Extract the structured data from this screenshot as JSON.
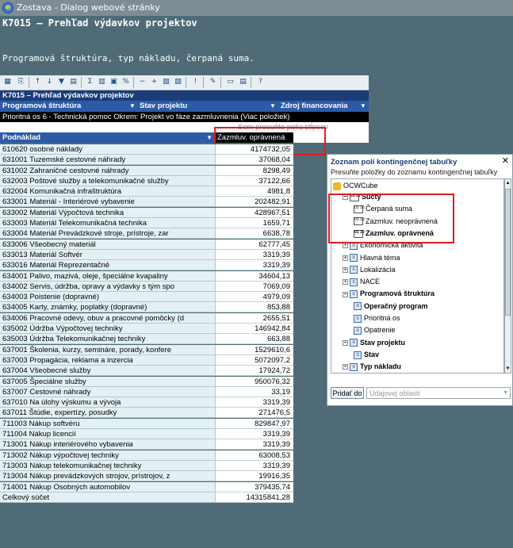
{
  "window": {
    "title": "Zostava - Dialog webové stránky"
  },
  "page": {
    "heading": "K7015 – Prehľad výdavkov projektov",
    "subheading": "Programová štruktúra, typ nákladu, čerpaná suma."
  },
  "pivot": {
    "title": "K7015 – Prehľad výdavkov projektov",
    "filter_fields": [
      "Programová štruktúra",
      "Stav projektu",
      "Zdroj financovania"
    ],
    "filter_row": "Prioritná os 6 - Technická pomoc Okrem: Projekt vo fáze zazmluvnenia (Viac položiek)",
    "drop_placeholder": "Sem presuňte polia stĺpcov",
    "row_header": "Podnáklad",
    "data_header": "Zazmluv. oprávnená",
    "rows": [
      {
        "label": "610620 osobné náklady",
        "value": "4174732,05"
      },
      {
        "label": "631001 Tuzemské cestovné náhrady",
        "value": "37068,04"
      },
      {
        "label": "631002 Zahraničné cestovné náhrady",
        "value": "8298,49"
      },
      {
        "label": "632003 Poštové služby a telekomunikačné služby",
        "value": "37122,66"
      },
      {
        "label": "632004 Komunikačná infraštruktúra",
        "value": "4981,8"
      },
      {
        "label": "633001 Materiál - Interiérové vybavenie",
        "value": "202482,91"
      },
      {
        "label": "633002 Materiál Výpočtová technika",
        "value": "428967,51"
      },
      {
        "label": "633003 Materiál Telekomunikačná technika",
        "value": "1659,71"
      },
      {
        "label": "633004 Materiál Prevádzkové stroje, prístroje, zar",
        "value": "6638,78"
      },
      {
        "label": "633006  Všeobecný materiál",
        "value": "62777,45"
      },
      {
        "label": "633013 Materiál Softvér",
        "value": "3319,39"
      },
      {
        "label": "633016 Materiál Reprezentačné",
        "value": "3319,39"
      },
      {
        "label": "634001  Palivo, mazivá, oleje, špeciálne kvapaliny",
        "value": "34604,13"
      },
      {
        "label": "634002  Servis, údržba, opravy a výdavky s tým spo",
        "value": "7069,09"
      },
      {
        "label": "634003  Poistenie (dopravné)",
        "value": "4979,09"
      },
      {
        "label": "634005  Karty, známky, poplatky (dopravné)",
        "value": "853,88"
      },
      {
        "label": "634006  Pracovné odevy, obuv a pracovné pomôcky (d",
        "value": "2655,51"
      },
      {
        "label": "635002 Údržba Výpočtovej techniky",
        "value": "146942,84"
      },
      {
        "label": "635003 Údržba Telekomunikačnej techniky",
        "value": "663,88"
      },
      {
        "label": "637001  Školenia, kurzy, semináre, porady, konfere",
        "value": "1529610,6"
      },
      {
        "label": "637003  Propagácia, reklama a inzercia",
        "value": "5072097,2"
      },
      {
        "label": "637004  Všeobecné služby",
        "value": "17924,72"
      },
      {
        "label": "637005  Špeciálne služby",
        "value": "950076,32"
      },
      {
        "label": "637007  Cestovné náhrady",
        "value": "33,19"
      },
      {
        "label": "637010  Na úlohy výskumu a vývoja",
        "value": "3319,39"
      },
      {
        "label": "637011  Štúdie, expertízy, posudky",
        "value": "271476,5"
      },
      {
        "label": "711003  Nákup softvéru",
        "value": "829847,97"
      },
      {
        "label": "711004  Nákup licencií",
        "value": "3319,39"
      },
      {
        "label": "713001  Nákup interiérového vybavenia",
        "value": "3319,39"
      },
      {
        "label": "713002  Nákup výpočtovej techniky",
        "value": "63008,53"
      },
      {
        "label": "713003  Nákup telekomunikačnej techniky",
        "value": "3319,39"
      },
      {
        "label": "713004  Nákup prevádzkových strojov, prístrojov, z",
        "value": "19916,35"
      },
      {
        "label": "714001  Nákup Osobných automobilov",
        "value": "379435,74"
      },
      {
        "label": "Celkový súčet",
        "value": "14315841,28"
      }
    ]
  },
  "field_list": {
    "title": "Zoznam polí kontingenčnej tabuľky",
    "subtitle": "Presuňte položky do zoznamu kontingenčnej tabuľky",
    "cube": "OCWCube",
    "items": [
      {
        "text": "Súčty",
        "bold": true,
        "icon": "10"
      },
      {
        "text": "Čerpaná suma",
        "bold": false,
        "icon": "measure"
      },
      {
        "text": "Zazmluv. neoprávnená",
        "bold": false,
        "icon": "measure"
      },
      {
        "text": "Zazmluv. oprávnená",
        "bold": true,
        "icon": "measure"
      },
      {
        "text": "Ekonomická aktivita",
        "bold": false,
        "icon": "dim"
      },
      {
        "text": "Hlavná téma",
        "bold": false,
        "icon": "dim"
      },
      {
        "text": "Lokalizácia",
        "bold": false,
        "icon": "dim"
      },
      {
        "text": "NACE",
        "bold": false,
        "icon": "dim"
      },
      {
        "text": "Programová štruktúra",
        "bold": true,
        "icon": "dim"
      },
      {
        "text": "Operačný program",
        "bold": true,
        "icon": "level"
      },
      {
        "text": "Prioritná os",
        "bold": false,
        "icon": "level"
      },
      {
        "text": "Opatrenie",
        "bold": false,
        "icon": "level"
      },
      {
        "text": "Stav projektu",
        "bold": true,
        "icon": "dim"
      },
      {
        "text": "Stav",
        "bold": true,
        "icon": "level"
      },
      {
        "text": "Typ nákladu",
        "bold": true,
        "icon": "dim"
      }
    ],
    "add_button": "Pridať do",
    "area_select": "Údajovej oblasti"
  }
}
